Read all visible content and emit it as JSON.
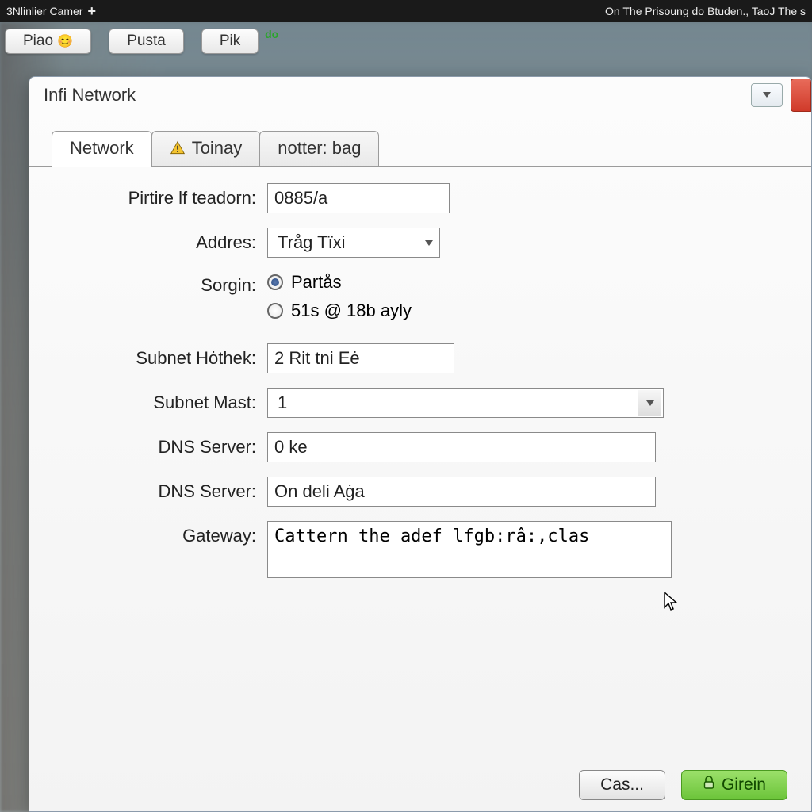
{
  "topbar": {
    "left": "3Nlinlier Camer",
    "right": "On The Prisoung do Btuden., TaoJ The s"
  },
  "tabrow": {
    "items": [
      "Piao",
      "Pusta",
      "Pik"
    ],
    "badge": "do"
  },
  "dialog": {
    "title": "Infi Network",
    "tabs": [
      "Network",
      "Toinay",
      "notter: bag"
    ],
    "form": {
      "pirtire_label": "Pirtire lf teadorn:",
      "pirtire_value": "0885/a",
      "addres_label": "Addres:",
      "addres_value": "Tråg Tïxi",
      "sorgin_label": "Sorgin:",
      "sorgin_opt1": "Partås",
      "sorgin_opt2": "51s @ 18b ayly",
      "subnet_hothek_label": "Subnet Hȯthek:",
      "subnet_hothek_value": "2 Rit tni Eė",
      "subnet_mast_label": "Subnet Mast:",
      "subnet_mast_value": "1",
      "dns1_label": "DNS Server:",
      "dns1_value": "0 ke",
      "dns2_label": "DNS Server:",
      "dns2_value": "On deli Aġa",
      "gateway_label": "Gateway:",
      "gateway_value": "Cattern the adef lfgb:râ:,clas"
    },
    "buttons": {
      "cancel": "Cas...",
      "ok": "Girein"
    }
  }
}
